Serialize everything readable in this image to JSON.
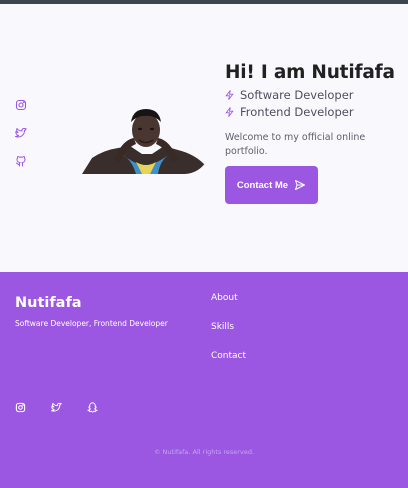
{
  "hero": {
    "heading": "Hi! I am Nutifafa",
    "roles": [
      "Software Developer",
      "Frontend Developer"
    ],
    "welcome_text": "Welcome to my official online portfolio.",
    "contact_button_label": "Contact Me",
    "side_social_icons": [
      "instagram-icon",
      "twitter-icon",
      "github-icon"
    ]
  },
  "footer": {
    "brand": "Nutifafa",
    "tagline": "Software Developer, Frontend Developer",
    "links": [
      "About",
      "Skills",
      "Contact"
    ],
    "social_icons": [
      "instagram-icon",
      "twitter-icon",
      "snapchat-icon"
    ],
    "copyright": "© Nutifafa. All rights reserved."
  },
  "colors": {
    "accent": "#9b56e2",
    "topbar": "#3c4650",
    "hero_background": "#f9f9fd"
  }
}
